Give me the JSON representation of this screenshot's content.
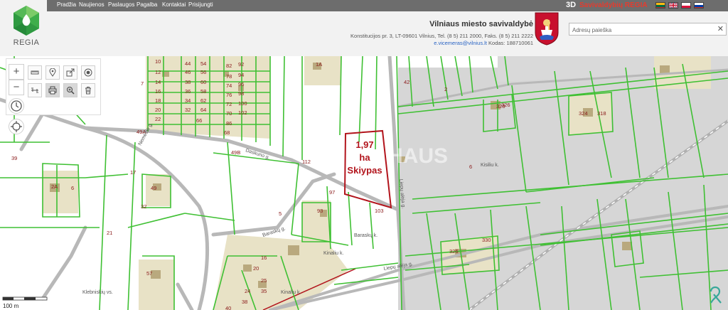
{
  "nav": {
    "items": [
      "Pradžia",
      "Naujienos",
      "Paslaugos",
      "Pagalba",
      "Kontaktai",
      "Prisijungti"
    ]
  },
  "logo": {
    "text": "REGIA"
  },
  "brand": {
    "prefix": "3D",
    "name": "Savivaldybių REGIA",
    "accent": "#e63b2e"
  },
  "languages": [
    "lt",
    "en",
    "pl",
    "ru"
  ],
  "municipality": {
    "title": "Vilniaus miesto savivaldybė",
    "address": "Konstitucijos pr. 3, LT-09601 Vilnius, Tel. (8 5) 211 2000, Faks. (8 5) 211 2222",
    "email": "e.vicemeras@vilnius.lt",
    "code": " Kodas: 188710061"
  },
  "search": {
    "placeholder": "Adresų paieška"
  },
  "map": {
    "plot_label": [
      "1,97",
      "ha",
      "Skiypas"
    ],
    "watermark": "HAUS",
    "scale_label": "100 m",
    "colors": {
      "boundary": "#3fc033",
      "road": "#b8b8b8",
      "plot_outline": "#b2141c",
      "label": "#8a1a1a"
    },
    "street_labels": [
      "Nemėžio g.",
      "Daskuno g.",
      "Liepų alėja g.",
      "Baraskų g.",
      "Baraskų k.",
      "Kisiliu k.",
      "Kinaliu k.",
      "Kinaliu k.",
      "Klebniskių vs.",
      "Liepų alėja g."
    ],
    "parcel_numbers": [
      "10",
      "44",
      "54",
      "12",
      "46",
      "56",
      "14",
      "38",
      "60",
      "16",
      "36",
      "58",
      "18",
      "34",
      "62",
      "20",
      "32",
      "64",
      "22",
      "66",
      "82",
      "92",
      "78",
      "94",
      "74",
      "96",
      "76",
      "98",
      "72",
      "100",
      "70",
      "102",
      "86",
      "68",
      "7",
      "49A",
      "49B",
      "112",
      "97",
      "103",
      "93",
      "5",
      "39",
      "17",
      "49",
      "32",
      "21",
      "6",
      "57",
      "16",
      "20",
      "25",
      "24",
      "35",
      "38",
      "40",
      "42",
      "2",
      "6",
      "326",
      "328",
      "330",
      "324",
      "318",
      "326",
      "1A",
      "2A",
      "16",
      "8"
    ]
  }
}
